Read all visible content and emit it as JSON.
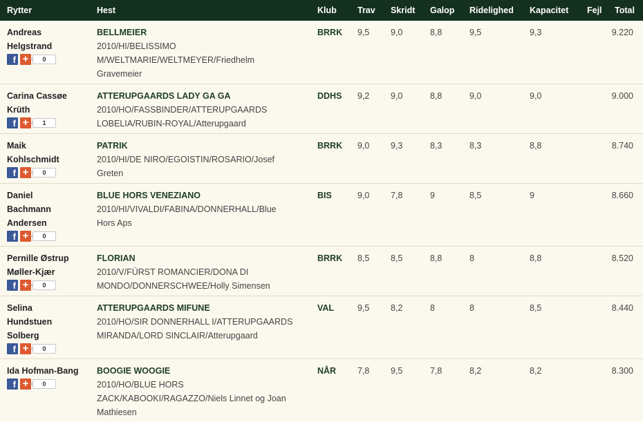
{
  "columns": {
    "rytter": "Rytter",
    "hest": "Hest",
    "klub": "Klub",
    "trav": "Trav",
    "skridt": "Skridt",
    "galop": "Galop",
    "ridelighed": "Ridelighed",
    "kapacitet": "Kapacitet",
    "fejl": "Fejl",
    "total": "Total"
  },
  "rows": [
    {
      "rider_lines": [
        "Andreas",
        "Helgstrand"
      ],
      "horse": "BELLMEIER",
      "horse_info_lines": [
        "2010/HI/BELISSIMO",
        "M/WELTMARIE/WELTMEYER/Friedhelm",
        "Gravemeier"
      ],
      "klub": "BRRK",
      "trav": "9,5",
      "skridt": "9,0",
      "galop": "8,8",
      "ridelighed": "9,5",
      "kapacitet": "9,3",
      "fejl": "",
      "total": "9.220",
      "share_count": "0"
    },
    {
      "rider_lines": [
        "Carina Cassøe",
        "Krüth"
      ],
      "horse": "ATTERUPGAARDS LADY GA GA",
      "horse_info_lines": [
        "2010/HO/FASSBINDER/ATTERUPGAARDS",
        "LOBELIA/RUBIN-ROYAL/Atterupgaard"
      ],
      "klub": "DDHS",
      "trav": "9,2",
      "skridt": "9,0",
      "galop": "8,8",
      "ridelighed": "9,0",
      "kapacitet": "9,0",
      "fejl": "",
      "total": "9.000",
      "share_count": "1"
    },
    {
      "rider_lines": [
        "Maik",
        "Kohlschmidt"
      ],
      "horse": "PATRIK",
      "horse_info_lines": [
        "2010/HI/DE NIRO/EGOISTIN/ROSARIO/Josef",
        "Greten"
      ],
      "klub": "BRRK",
      "trav": "9,0",
      "skridt": "9,3",
      "galop": "8,3",
      "ridelighed": "8,3",
      "kapacitet": "8,8",
      "fejl": "",
      "total": "8.740",
      "share_count": "0"
    },
    {
      "rider_lines": [
        "Daniel",
        "Bachmann",
        "Andersen"
      ],
      "horse": "BLUE HORS VENEZIANO",
      "horse_info_lines": [
        "2010/HI/VIVALDI/FABINA/DONNERHALL/Blue",
        "Hors Aps"
      ],
      "klub": "BIS",
      "trav": "9,0",
      "skridt": "7,8",
      "galop": "9",
      "ridelighed": "8,5",
      "kapacitet": "9",
      "fejl": "",
      "total": "8.660",
      "share_count": "0"
    },
    {
      "rider_lines": [
        "Pernille Østrup",
        "Møller-Kjær"
      ],
      "horse": "FLORIAN",
      "horse_info_lines": [
        "2010/V/FÜRST ROMANCIER/DONA DI",
        "MONDO/DONNERSCHWEE/Holly Simensen"
      ],
      "klub": "BRRK",
      "trav": "8,5",
      "skridt": "8,5",
      "galop": "8,8",
      "ridelighed": "8",
      "kapacitet": "8,8",
      "fejl": "",
      "total": "8.520",
      "share_count": "0"
    },
    {
      "rider_lines": [
        "Selina",
        "Hundstuen",
        "Solberg"
      ],
      "horse": "ATTERUPGAARDS MIFUNE",
      "horse_info_lines": [
        "2010/HO/SIR DONNERHALL I/ATTERUPGAARDS",
        "MIRANDA/LORD SINCLAIR/Atterupgaard"
      ],
      "klub": "VAL",
      "trav": "9,5",
      "skridt": "8,2",
      "galop": "8",
      "ridelighed": "8",
      "kapacitet": "8,5",
      "fejl": "",
      "total": "8.440",
      "share_count": "0"
    },
    {
      "rider_lines": [
        "Ida Hofman-Bang"
      ],
      "horse": "BOOGIE WOOGIE",
      "horse_info_lines": [
        "2010/HO/BLUE HORS",
        "ZACK/KABOOKI/RAGAZZO/Niels Linnet og Joan",
        "Mathiesen"
      ],
      "klub": "NÅR",
      "trav": "7,8",
      "skridt": "9,5",
      "galop": "7,8",
      "ridelighed": "8,2",
      "kapacitet": "8,2",
      "fejl": "",
      "total": "8.300",
      "share_count": "0"
    }
  ],
  "icons": {
    "facebook": "facebook-icon",
    "google_plus": "google-plus-icon"
  },
  "colors": {
    "header_bg": "#14301f",
    "row_bg": "#fbf9ee",
    "facebook": "#3b5998",
    "google_plus": "#dd5a30"
  }
}
